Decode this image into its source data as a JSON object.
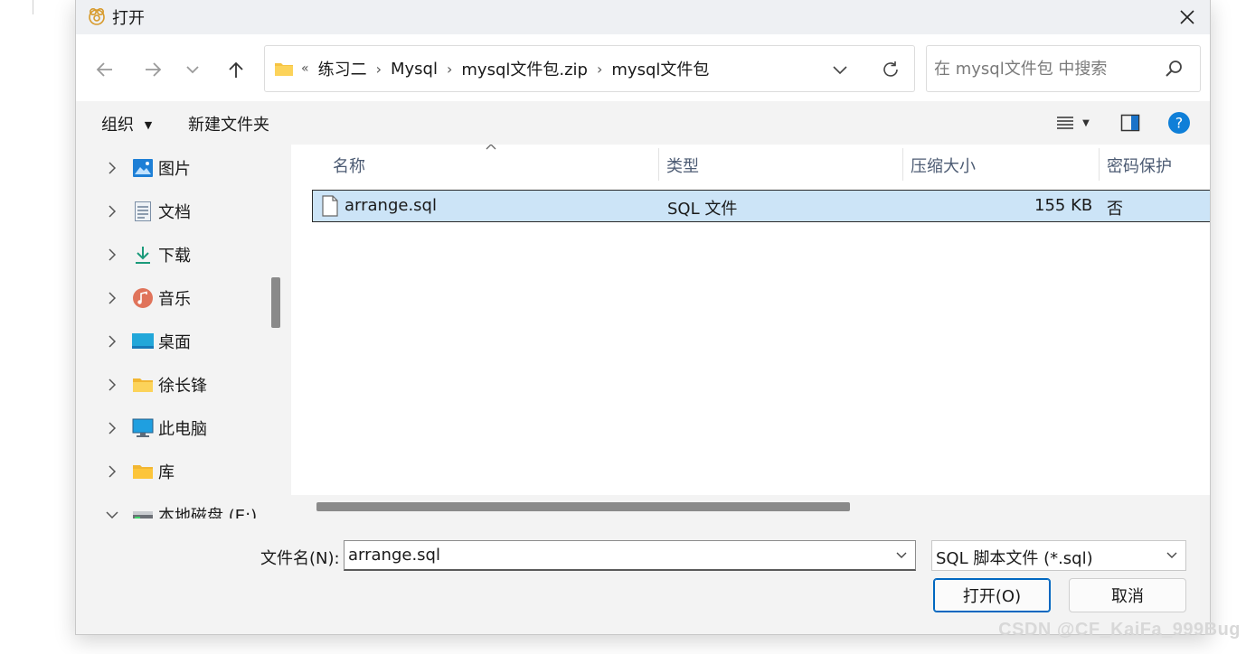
{
  "window": {
    "title": "打开"
  },
  "address_bar": {
    "overflow_marker": "«",
    "crumbs": [
      "练习二",
      "Mysql",
      "mysql文件包.zip",
      "mysql文件包"
    ]
  },
  "search": {
    "placeholder": "在 mysql文件包 中搜索"
  },
  "toolbar": {
    "organize_label": "组织",
    "new_folder_label": "新建文件夹"
  },
  "nav_items": [
    {
      "label": "图片",
      "icon": "pictures-icon"
    },
    {
      "label": "文档",
      "icon": "documents-icon"
    },
    {
      "label": "下载",
      "icon": "download-icon"
    },
    {
      "label": "音乐",
      "icon": "music-icon"
    },
    {
      "label": "桌面",
      "icon": "desktop-icon"
    },
    {
      "label": "徐长锋",
      "icon": "user-folder-icon"
    },
    {
      "label": "此电脑",
      "icon": "computer-icon"
    },
    {
      "label": "库",
      "icon": "library-icon"
    },
    {
      "label": "本地磁盘 (E:)",
      "icon": "drive-icon"
    }
  ],
  "columns": {
    "name": "名称",
    "type": "类型",
    "size": "压缩大小",
    "password": "密码保护"
  },
  "files": [
    {
      "name": "arrange.sql",
      "type": "SQL 文件",
      "size": "155 KB",
      "password": "否"
    }
  ],
  "bottom": {
    "filename_label": "文件名(N):",
    "filename_value": "arrange.sql",
    "filetype_value": "SQL 脚本文件 (*.sql)",
    "open_label": "打开(O)",
    "cancel_label": "取消"
  },
  "watermark": "CSDN @CF_KaiFa_999Bug",
  "colors": {
    "selection": "#cce4f7",
    "accent": "#0067c0",
    "help": "#0f7fd8",
    "folder": "#f6c342"
  }
}
